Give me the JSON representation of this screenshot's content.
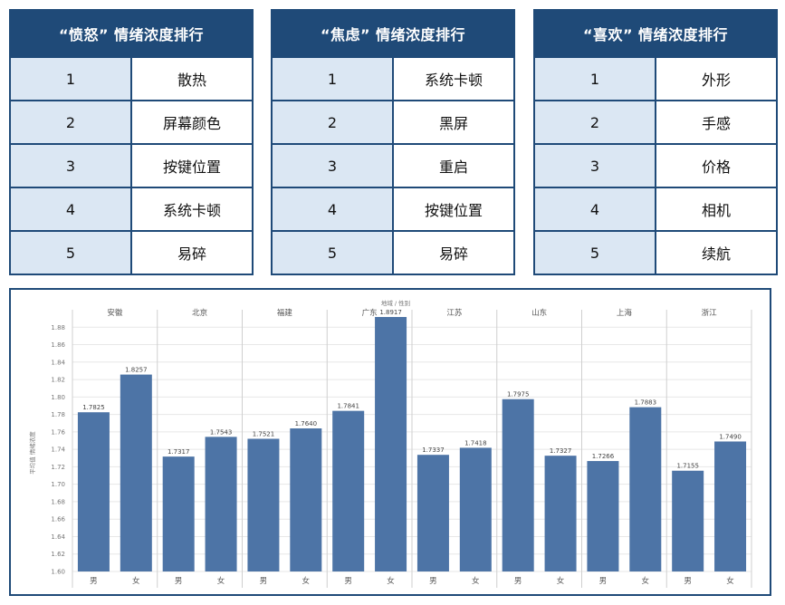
{
  "tables": [
    {
      "title": "“愤怒” 情绪浓度排行",
      "rows": [
        {
          "rank": "1",
          "item": "散热"
        },
        {
          "rank": "2",
          "item": "屏幕颜色"
        },
        {
          "rank": "3",
          "item": "按键位置"
        },
        {
          "rank": "4",
          "item": "系统卡顿"
        },
        {
          "rank": "5",
          "item": "易碎"
        }
      ]
    },
    {
      "title": "“焦虑” 情绪浓度排行",
      "rows": [
        {
          "rank": "1",
          "item": "系统卡顿"
        },
        {
          "rank": "2",
          "item": "黑屏"
        },
        {
          "rank": "3",
          "item": "重启"
        },
        {
          "rank": "4",
          "item": "按键位置"
        },
        {
          "rank": "5",
          "item": "易碎"
        }
      ]
    },
    {
      "title": "“喜欢” 情绪浓度排行",
      "rows": [
        {
          "rank": "1",
          "item": "外形"
        },
        {
          "rank": "2",
          "item": "手感"
        },
        {
          "rank": "3",
          "item": "价格"
        },
        {
          "rank": "4",
          "item": "相机"
        },
        {
          "rank": "5",
          "item": "续航"
        }
      ]
    }
  ],
  "chart_data": {
    "type": "bar",
    "title": "地域 / 性别",
    "ylabel": "平均值 情绪浓度",
    "ylim": [
      1.6,
      1.9
    ],
    "yticks": [
      "1.60",
      "1.62",
      "1.64",
      "1.66",
      "1.68",
      "1.70",
      "1.72",
      "1.74",
      "1.76",
      "1.78",
      "1.80",
      "1.82",
      "1.84",
      "1.86",
      "1.88"
    ],
    "grid": true,
    "bar_color": "#4d74a6",
    "groups": [
      {
        "region": "安徽",
        "bars": [
          {
            "gender": "男",
            "value": 1.7825,
            "label": "1.7825"
          },
          {
            "gender": "女",
            "value": 1.8257,
            "label": "1.8257"
          }
        ]
      },
      {
        "region": "北京",
        "bars": [
          {
            "gender": "男",
            "value": 1.7317,
            "label": "1.7317"
          },
          {
            "gender": "女",
            "value": 1.7543,
            "label": "1.7543"
          }
        ]
      },
      {
        "region": "福建",
        "bars": [
          {
            "gender": "男",
            "value": 1.7521,
            "label": "1.7521"
          },
          {
            "gender": "女",
            "value": 1.764,
            "label": "1.7640"
          }
        ]
      },
      {
        "region": "广东",
        "bars": [
          {
            "gender": "男",
            "value": 1.7841,
            "label": "1.7841"
          },
          {
            "gender": "女",
            "value": 1.8917,
            "label": "1.8917"
          }
        ]
      },
      {
        "region": "江苏",
        "bars": [
          {
            "gender": "男",
            "value": 1.7337,
            "label": "1.7337"
          },
          {
            "gender": "女",
            "value": 1.7418,
            "label": "1.7418"
          }
        ]
      },
      {
        "region": "山东",
        "bars": [
          {
            "gender": "男",
            "value": 1.7975,
            "label": "1.7975"
          },
          {
            "gender": "女",
            "value": 1.7327,
            "label": "1.7327"
          }
        ]
      },
      {
        "region": "上海",
        "bars": [
          {
            "gender": "男",
            "value": 1.7266,
            "label": "1.7266"
          },
          {
            "gender": "女",
            "value": 1.7883,
            "label": "1.7883"
          }
        ]
      },
      {
        "region": "浙江",
        "bars": [
          {
            "gender": "男",
            "value": 1.7155,
            "label": "1.7155"
          },
          {
            "gender": "女",
            "value": 1.749,
            "label": "1.7490"
          }
        ]
      }
    ]
  }
}
